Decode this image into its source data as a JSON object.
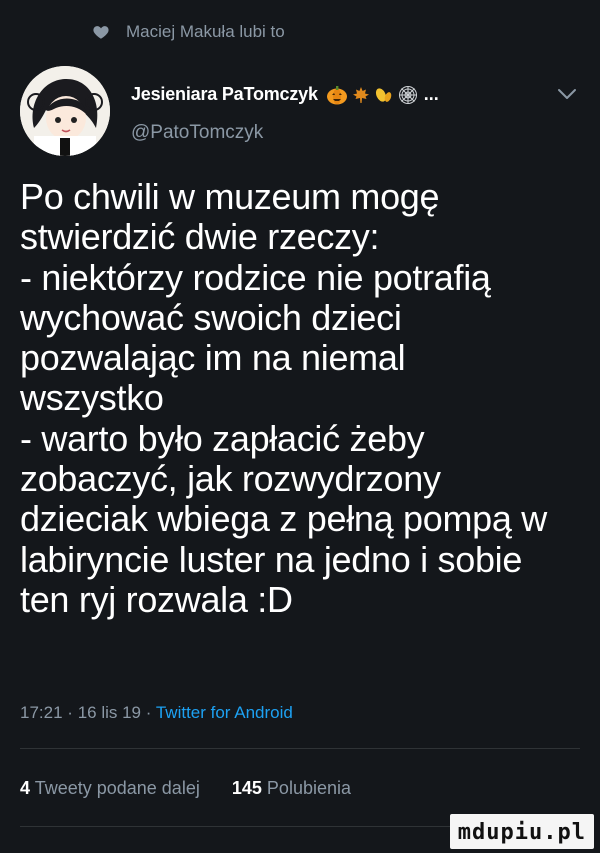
{
  "liked_by": {
    "text": "Maciej Makuła lubi to",
    "icon": "heart-icon"
  },
  "author": {
    "display_name": "Jesieniara PaTomczyk",
    "ellipsis": "...",
    "handle": "@PatoTomczyk",
    "emoji_icons": [
      "pumpkin-icon",
      "maple-leaf-icon",
      "yellow-leaves-icon",
      "spiderweb-icon"
    ],
    "menu_icon": "chevron-down-icon"
  },
  "tweet": {
    "text": "Po chwili w muzeum mogę\nstwierdzić dwie rzeczy:\n- niektórzy rodzice nie potrafią\nwychować swoich dzieci\npozwalając im na niemal\nwszystko\n- warto było zapłacić żeby\nzobaczyć, jak rozwydrzony\ndzieciak wbiega z pełną pompą w\nlabiryncie luster na jedno i sobie\nten ryj rozwala :D"
  },
  "meta": {
    "time": "17:21",
    "separator": "·",
    "date": "16 lis 19",
    "client": "Twitter for Android"
  },
  "stats": {
    "retweets_count": "4",
    "retweets_label": "Tweety podane dalej",
    "likes_count": "145",
    "likes_label": "Polubienia"
  },
  "watermark": {
    "text": "mdupiu.pl"
  },
  "colors": {
    "background": "#14171b",
    "text_primary": "#ffffff",
    "text_secondary": "#8b98a5",
    "link": "#1da1f2",
    "divider": "#2f3336"
  }
}
